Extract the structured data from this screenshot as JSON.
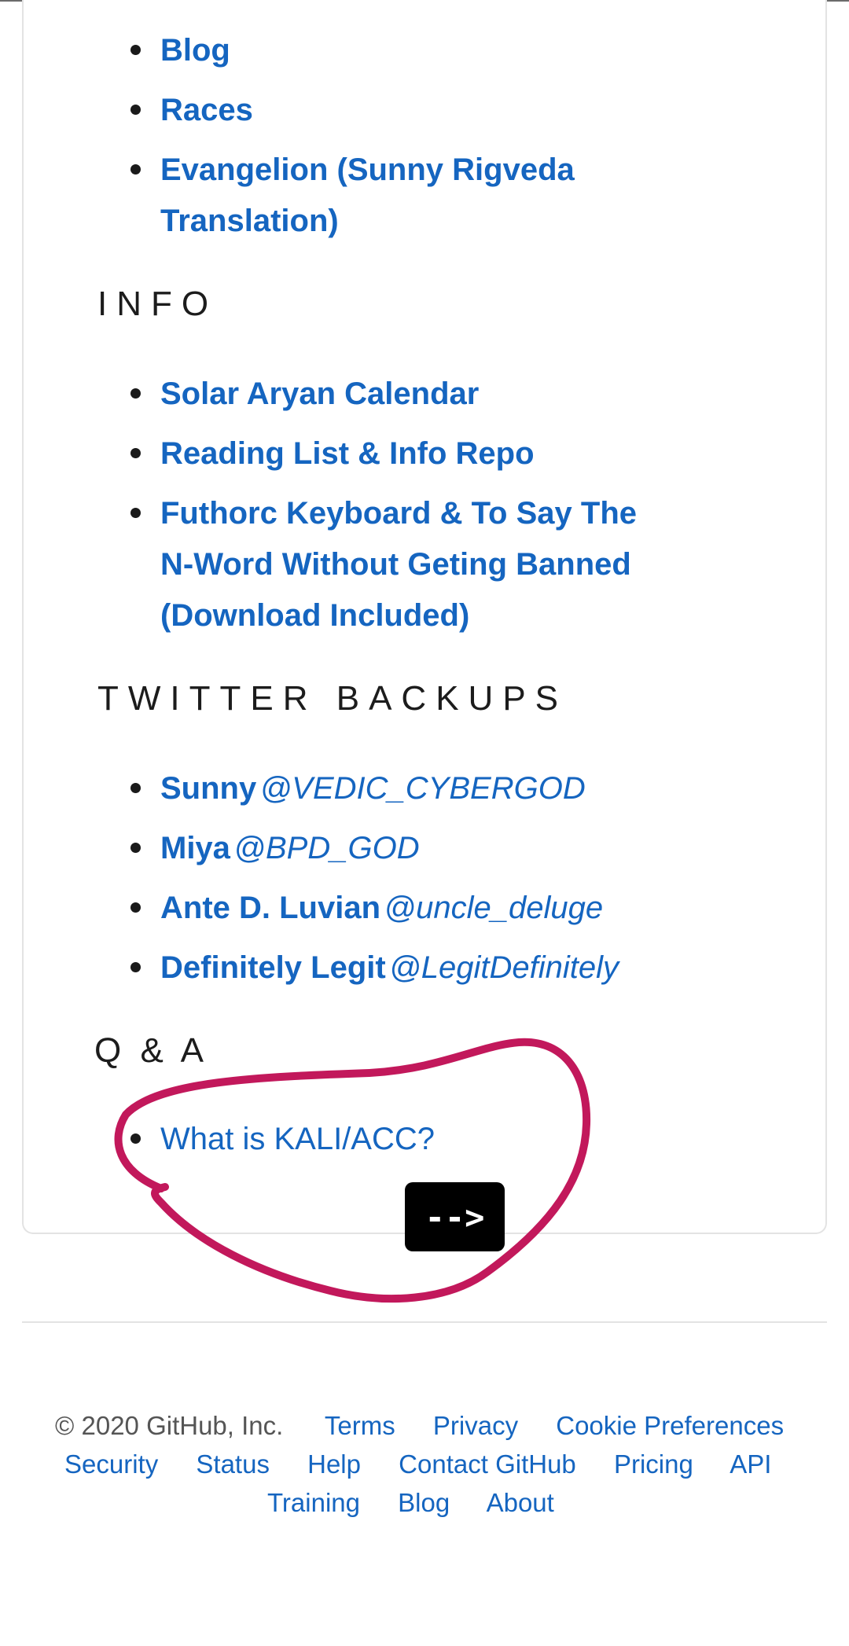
{
  "nav_links": [
    {
      "label": "Blog"
    },
    {
      "label": "Races"
    },
    {
      "label_line1": "Evangelion (Sunny Rigveda",
      "label_line2": "Translation)"
    }
  ],
  "info": {
    "heading": "INFO",
    "items": [
      {
        "label": "Solar Aryan Calendar"
      },
      {
        "label": "Reading List & Info Repo"
      },
      {
        "line1": "Futhorc Keyboard & To Say The",
        "line2": "N-Word Without Geting Banned",
        "line3": "(Download Included)"
      }
    ]
  },
  "twitter": {
    "heading": "TWITTER BACKUPS",
    "items": [
      {
        "name": "Sunny",
        "handle": "@VEDIC_CYBERGOD"
      },
      {
        "name": "Miya",
        "handle": "@BPD_GOD"
      },
      {
        "name": "Ante D. Luvian",
        "handle": "@uncle_deluge"
      },
      {
        "name": "Definitely Legit",
        "handle": "@LegitDefinitely"
      }
    ]
  },
  "qa": {
    "heading": "Q & A",
    "items": [
      {
        "label": "What is KALI/ACC?"
      }
    ]
  },
  "arrow_button": {
    "label": "-->"
  },
  "annotation": {
    "color": "#c2185b"
  },
  "footer": {
    "copyright": "© 2020 GitHub, Inc.",
    "row1": [
      "Terms",
      "Privacy",
      "Cookie Preferences"
    ],
    "row2": [
      "Security",
      "Status",
      "Help",
      "Contact GitHub",
      "Pricing",
      "API"
    ],
    "row3": [
      "Training",
      "Blog",
      "About"
    ]
  },
  "colors": {
    "link": "#1565c0",
    "text": "#1c1c1c",
    "muted": "#555555"
  }
}
